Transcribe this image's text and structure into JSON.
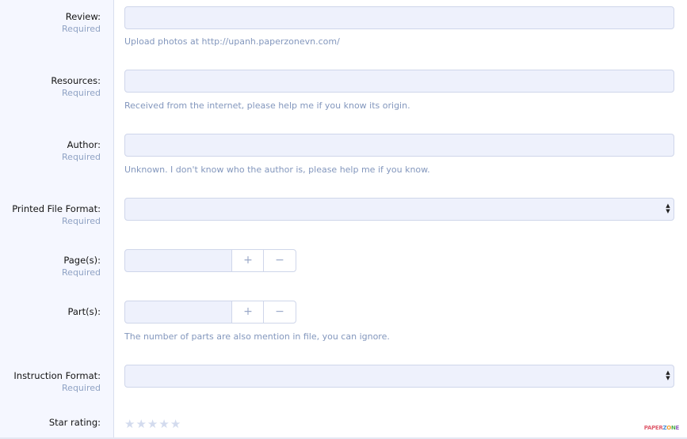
{
  "form": {
    "review": {
      "label": "Review:",
      "required": "Required",
      "hint": "Upload photos at http://upanh.paperzonevn.com/",
      "value": ""
    },
    "resources": {
      "label": "Resources:",
      "required": "Required",
      "hint": "Received from the internet, please help me if you know its origin.",
      "value": ""
    },
    "author": {
      "label": "Author:",
      "required": "Required",
      "hint": "Unknown. I don't know who the author is, please help me if you know.",
      "value": ""
    },
    "printed_file_format": {
      "label": "Printed File Format:",
      "required": "Required",
      "selected": ""
    },
    "pages": {
      "label": "Page(s):",
      "required": "Required",
      "value": "",
      "plus": "+",
      "minus": "−"
    },
    "parts": {
      "label": "Part(s):",
      "value": "",
      "plus": "+",
      "minus": "−",
      "hint": "The number of parts are also mention in file, you can ignore."
    },
    "instruction_format": {
      "label": "Instruction Format:",
      "required": "Required",
      "selected": ""
    },
    "star_rating": {
      "label": "Star rating:",
      "max": 5,
      "value": 0,
      "star_glyph": "★"
    }
  },
  "colors": {
    "label_bg": "#f5f7ff",
    "input_bg": "#eef1fc",
    "hint": "#8397bd",
    "required": "#8fa2c4"
  },
  "icons": {
    "select": "updown-arrows-icon",
    "star": "star-icon"
  }
}
